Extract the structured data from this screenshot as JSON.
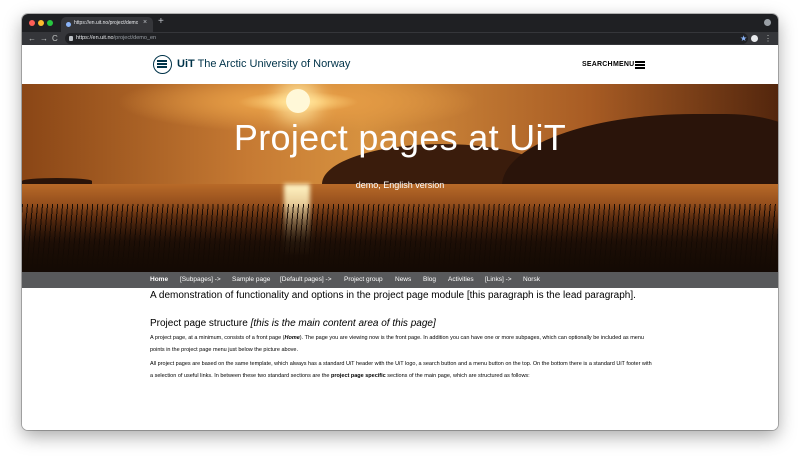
{
  "browser": {
    "tab_title": "https://en.uit.no/project/demo...",
    "tab_close": "×",
    "new_tab": "+",
    "nav_back": "←",
    "nav_forward": "→",
    "reload": "C",
    "url_domain": "https://en.uit.no",
    "url_path": "/project/demo_en",
    "star": "★",
    "menu_dots": "⋮"
  },
  "header": {
    "logo_bold": "UiT",
    "logo_rest": " The Arctic University of Norway",
    "search_label": "SEARCH",
    "menu_label": "MENU"
  },
  "hero": {
    "title": "Project pages at UiT",
    "subtitle": "demo, English version"
  },
  "project_nav": {
    "items": [
      {
        "label": "Home",
        "active": true
      },
      {
        "label": "[Subpages] ->",
        "active": false
      },
      {
        "label": "Sample page",
        "active": false
      },
      {
        "label": "[Default pages] ->",
        "active": false
      },
      {
        "label": "Project group",
        "active": false
      },
      {
        "label": "News",
        "active": false
      },
      {
        "label": "Blog",
        "active": false
      },
      {
        "label": "Activities",
        "active": false
      },
      {
        "label": "[Links] ->",
        "active": false
      },
      {
        "label": "Norsk",
        "active": false
      }
    ]
  },
  "content": {
    "lead": "A demonstration of functionality and options in the project page module [this paragraph is the lead paragraph].",
    "heading_main": "Project page structure ",
    "heading_italic": "[this is the main content area of this page]",
    "p1_a": "A project page, at a minimum, consists of a front page (",
    "p1_home": "Home",
    "p1_b": "). The page you are viewing now is the front page. In addition you can have one or more subpages, which can optionally be included as menu points in the project page menu just below the picture above.",
    "p2_a": "All project pages are based on the same template, which always has a standard UiT header with the UiT logo, a search button and a menu button on the top. On the bottom there is a standard UiT footer with a selection of useful links. In between these two standard sections are the ",
    "p2_bold": "project page specific",
    "p2_b": " sections of the main page, which are structured as follows:"
  },
  "colors": {
    "uit_blue": "#003349",
    "nav_grey": "#58595b"
  }
}
